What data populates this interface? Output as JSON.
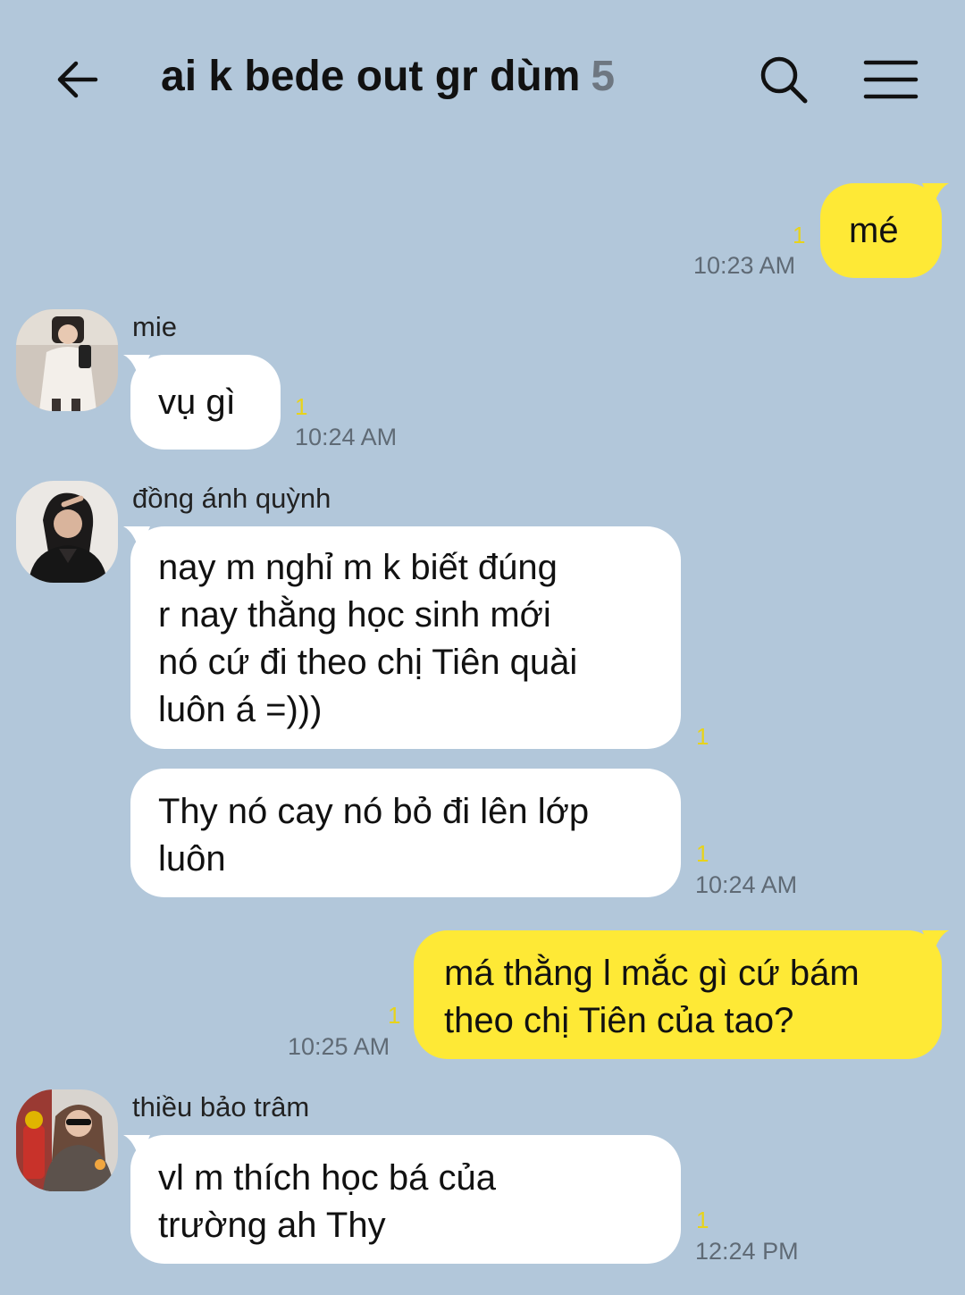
{
  "header": {
    "title": "ai k bede out gr dùm",
    "member_count": "5",
    "icons": [
      "back-arrow-icon",
      "search-icon",
      "menu-icon"
    ]
  },
  "colors": {
    "background": "#b2c7da",
    "my_bubble": "#fee936",
    "their_bubble": "#ffffff",
    "unread": "#e8d31a"
  },
  "messages": [
    {
      "from": "me",
      "text": "mé",
      "unread": "1",
      "time": "10:23 AM"
    },
    {
      "from": "mie",
      "sender": "mie",
      "text": "vụ gì",
      "unread": "1",
      "time": "10:24 AM"
    },
    {
      "from": "đồng ánh quỳnh",
      "sender": "đồng ánh quỳnh",
      "lines": [
        "nay m nghỉ m k biết đúng",
        "r nay thằng học sinh mới",
        "nó cứ đi theo chị Tiên quài",
        "luôn á =)))"
      ],
      "unread": "1"
    },
    {
      "from": "đồng ánh quỳnh",
      "lines": [
        "Thy nó cay nó bỏ đi lên lớp",
        "luôn"
      ],
      "unread": "1",
      "time": "10:24 AM"
    },
    {
      "from": "me",
      "lines": [
        "má thằng l mắc gì cứ bám",
        "theo chị Tiên của tao?"
      ],
      "unread": "1",
      "time": "10:25 AM"
    },
    {
      "from": "thiều bảo trâm",
      "sender": "thiều bảo trâm",
      "lines": [
        "vl m thích học bá của",
        "trường ah Thy"
      ],
      "unread": "1",
      "time": "12:24 PM"
    }
  ]
}
